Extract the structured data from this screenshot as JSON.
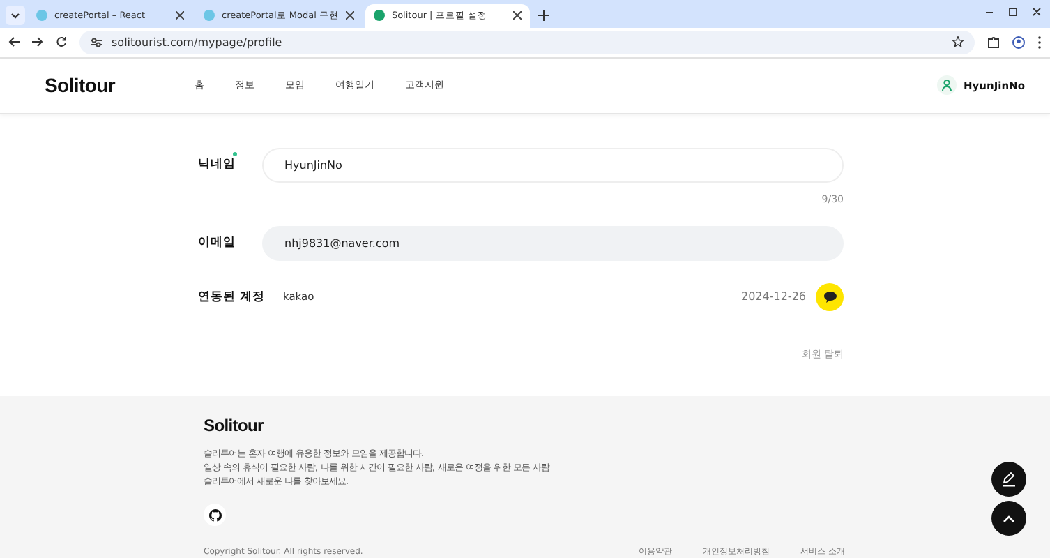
{
  "browser": {
    "tabs": [
      {
        "title": "createPortal – React",
        "selected": false
      },
      {
        "title": "createPortal로 Modal 구현",
        "selected": false
      },
      {
        "title": "Solitour | 프로필 설정",
        "selected": true
      }
    ],
    "address": "solitourist.com/mypage/profile"
  },
  "header": {
    "logo": "Solitour",
    "nav": [
      "홈",
      "정보",
      "모임",
      "여행일기",
      "고객지원"
    ],
    "user": "HyunJinNo"
  },
  "profile": {
    "nickname": {
      "label": "닉네임",
      "required": true,
      "value": "HyunJinNo",
      "counter": "9/30"
    },
    "email": {
      "label": "이메일",
      "value": "nhj9831@naver.com",
      "disabled": true
    },
    "linked": {
      "label": "연동된 계정",
      "provider": "kakao",
      "date": "2024-12-26"
    },
    "withdraw": "회원 탈퇴"
  },
  "footer": {
    "logo": "Solitour",
    "description": [
      "솔리투어는 혼자 여행에 유용한 정보와 모임을 제공합니다.",
      "일상 속의 휴식이 필요한 사람, 나를 위한 시간이 필요한 사람, 새로운 여정을 위한 모든 사람",
      "솔리투어에서 새로운 나를 찾아보세요."
    ],
    "copyright": "Copyright Solitour. All rights reserved.",
    "links": [
      "이용약관",
      "개인정보처리방침",
      "서비스 소개"
    ]
  }
}
